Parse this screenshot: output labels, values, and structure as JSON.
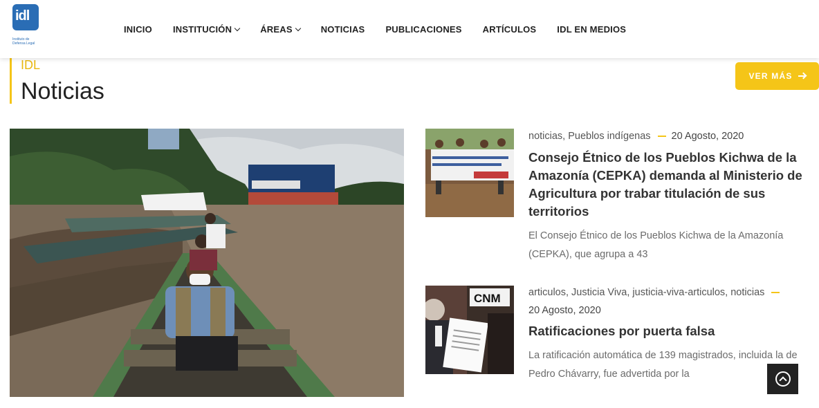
{
  "header": {
    "logo_mark": "idl",
    "logo_caption": "Instituto de Defensa Legal",
    "nav": [
      {
        "label": "INICIO"
      },
      {
        "label": "INSTITUCIÓN"
      },
      {
        "label": "ÁREAS"
      },
      {
        "label": "NOTICIAS"
      },
      {
        "label": "PUBLICACIONES"
      },
      {
        "label": "ARTÍCULOS"
      },
      {
        "label": "IDL EN MEDIOS"
      }
    ]
  },
  "section": {
    "kicker": "IDL",
    "title": "Noticias",
    "ver_mas": "VER MÁS"
  },
  "news": [
    {
      "categories": "noticias, Pueblos indígenas",
      "date": "20 Agosto, 2020",
      "title": "Consejo Étnico de los Pueblos Kichwa de la Amazonía (CEPKA) demanda al Ministerio de Agricultura por trabar titulación de sus territorios",
      "excerpt": "El Consejo Étnico de los Pueblos Kichwa de la Amazonía (CEPKA), que agrupa a 43"
    },
    {
      "categories": "articulos, Justicia Viva, justicia-viva-articulos, noticias",
      "date": "20 Agosto, 2020",
      "title": "Ratificaciones por puerta falsa",
      "excerpt": "La ratificación automática de 139 magistrados, incluida la de Pedro Chávarry, fue advertida por la"
    }
  ],
  "colors": {
    "accent": "#f5c518",
    "brand": "#2a6db5"
  }
}
